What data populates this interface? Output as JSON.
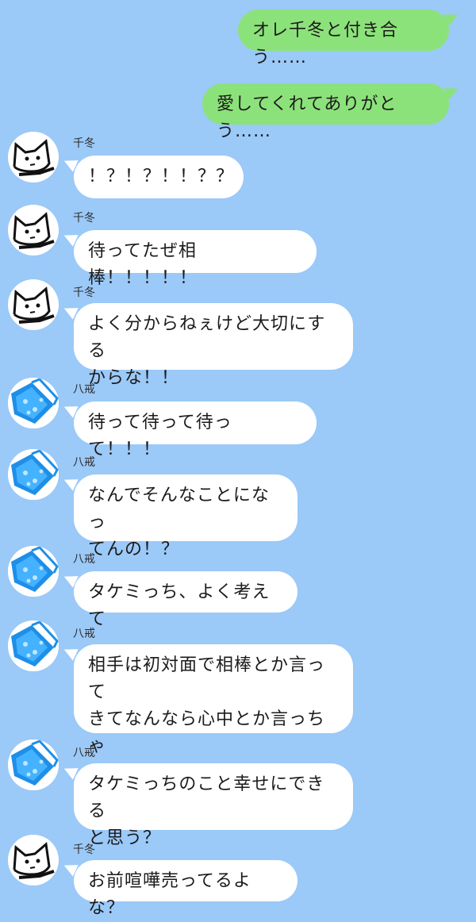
{
  "colors": {
    "background": "#9bc9f8",
    "sent_bubble": "#8ce27a",
    "received_bubble": "#ffffff"
  },
  "messages": [
    {
      "from": "me",
      "text": "オレ千冬と付き合う……"
    },
    {
      "from": "me",
      "text": "愛してくれてありがとう……"
    },
    {
      "from": "chifuyu",
      "sender": "千冬",
      "avatar": "cat-avatar-icon",
      "text": "！？！？！！？？"
    },
    {
      "from": "chifuyu",
      "sender": "千冬",
      "avatar": "cat-avatar-icon",
      "text": "待ってたぜ相棒！！！！！"
    },
    {
      "from": "chifuyu",
      "sender": "千冬",
      "avatar": "cat-avatar-icon",
      "text": "よく分からねぇけど大切にする\nからな！！"
    },
    {
      "from": "hakkai",
      "sender": "八戒",
      "avatar": "blue-pattern-avatar-icon",
      "text": "待って待って待って！！！"
    },
    {
      "from": "hakkai",
      "sender": "八戒",
      "avatar": "blue-pattern-avatar-icon",
      "text": "なんでそんなことになっ\nてんの！？"
    },
    {
      "from": "hakkai",
      "sender": "八戒",
      "avatar": "blue-pattern-avatar-icon",
      "text": "タケミっち、よく考えて"
    },
    {
      "from": "hakkai",
      "sender": "八戒",
      "avatar": "blue-pattern-avatar-icon",
      "text": "相手は初対面で相棒とか言って\nきてなんなら心中とか言っちゃ\nう激重感情メンヘラ男だよ？"
    },
    {
      "from": "hakkai",
      "sender": "八戒",
      "avatar": "blue-pattern-avatar-icon",
      "text": "タケミっちのこと幸せにできる\nと思う？"
    },
    {
      "from": "chifuyu",
      "sender": "千冬",
      "avatar": "cat-avatar-icon",
      "text": "お前喧嘩売ってるよな？"
    }
  ]
}
